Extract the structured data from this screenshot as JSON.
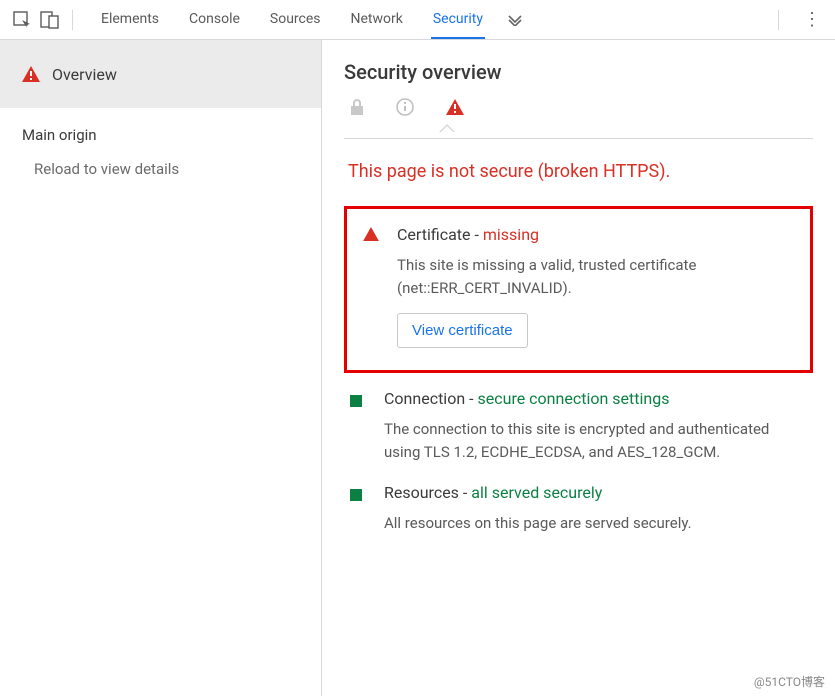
{
  "tabs": {
    "elements": "Elements",
    "console": "Console",
    "sources": "Sources",
    "network": "Network",
    "security": "Security"
  },
  "sidebar": {
    "overview": "Overview",
    "main_origin": "Main origin",
    "reload_hint": "Reload to view details"
  },
  "main": {
    "heading": "Security overview",
    "warning": "This page is not secure (broken HTTPS).",
    "certificate": {
      "label": "Certificate",
      "status": "missing",
      "desc": "This site is missing a valid, trusted certificate (net::ERR_CERT_INVALID).",
      "button": "View certificate"
    },
    "connection": {
      "label": "Connection",
      "status": "secure connection settings",
      "desc": "The connection to this site is encrypted and authenticated using TLS 1.2, ECDHE_ECDSA, and AES_128_GCM."
    },
    "resources": {
      "label": "Resources",
      "status": "all served securely",
      "desc": "All resources on this page are served securely."
    }
  },
  "watermark": "@51CTO博客"
}
